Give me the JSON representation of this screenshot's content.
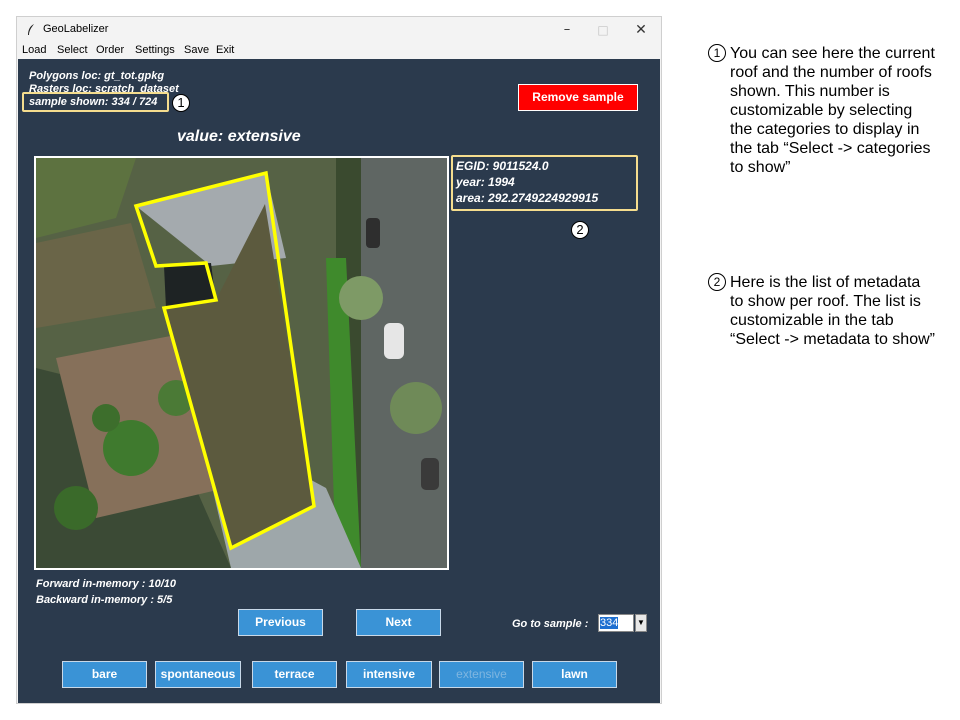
{
  "window": {
    "title": "GeoLabelizer",
    "controls": {
      "minimize": "–",
      "maximize": "□",
      "close": "✕"
    }
  },
  "menu": [
    "Load",
    "Select",
    "Order",
    "Settings",
    "Save",
    "Exit"
  ],
  "info": {
    "polygons": "Polygons loc: gt_tot.gpkg",
    "rasters": "Rasters loc: scratch_dataset",
    "sample_shown": "sample shown: 334 / 724"
  },
  "remove_button": "Remove sample",
  "value_label": "value: extensive",
  "metadata": [
    "EGID: 9011524.0",
    "year: 1994",
    "area: 292.2749224929915"
  ],
  "memory": {
    "forward": "Forward in-memory : 10/10",
    "backward": "Backward in-memory : 5/5"
  },
  "nav": {
    "previous": "Previous",
    "next": "Next"
  },
  "goto": {
    "label": "Go to sample :",
    "value": "334"
  },
  "categories": [
    {
      "label": "bare",
      "disabled": false
    },
    {
      "label": "spontaneous",
      "disabled": false
    },
    {
      "label": "terrace",
      "disabled": false
    },
    {
      "label": "intensive",
      "disabled": false
    },
    {
      "label": "extensive",
      "disabled": true
    },
    {
      "label": "lawn",
      "disabled": false
    }
  ],
  "callouts": {
    "one": "1",
    "two": "2"
  },
  "notes": [
    {
      "num": "1",
      "text": "You can see here the current roof and the number of roofs shown. This number is customizable by selecting the categories to display in the tab “Select -> categories to show”"
    },
    {
      "num": "2",
      "text": "Here is the list of metadata to show per roof. The list is customizable in the tab “Select -> metadata to show”"
    }
  ],
  "colors": {
    "client_bg": "#2b3a4d",
    "button_blue": "#3a93d6",
    "remove_red": "#ff0000",
    "callout_border": "#f5dd8e",
    "polygon_outline": "#ffff00"
  }
}
